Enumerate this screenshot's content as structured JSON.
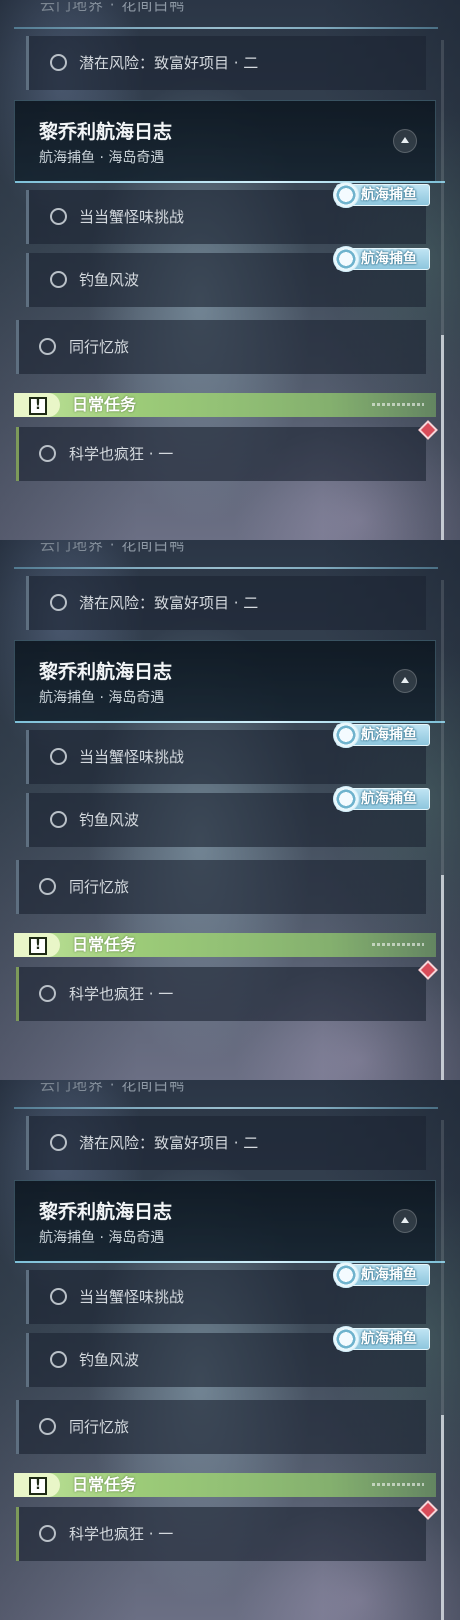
{
  "panels": [
    {
      "cut_text": "云门地界 · 花间白鸭",
      "hidden_item": "潜在风险：致富好项目 · 二",
      "quest_group": {
        "title": "黎乔利航海日志",
        "subtitle": "航海捕鱼 · 海岛奇遇",
        "collapse_icon": "chevron-up-icon"
      },
      "sub_quests": [
        {
          "label": "当当蟹怪味挑战",
          "tag": "航海捕鱼"
        },
        {
          "label": "钓鱼风波",
          "tag": "航海捕鱼"
        }
      ],
      "other_quest": "同行忆旅",
      "daily_section": {
        "title": "日常任务",
        "icon": "exclamation-icon"
      },
      "daily_quests": [
        "科学也疯狂 · 一"
      ]
    },
    {
      "cut_text": "云门地界 · 花间白鸭",
      "hidden_item": "潜在风险：致富好项目 · 二",
      "quest_group": {
        "title": "黎乔利航海日志",
        "subtitle": "航海捕鱼 · 海岛奇遇",
        "collapse_icon": "chevron-up-icon"
      },
      "sub_quests": [
        {
          "label": "当当蟹怪味挑战",
          "tag": "航海捕鱼"
        },
        {
          "label": "钓鱼风波",
          "tag": "航海捕鱼"
        }
      ],
      "other_quest": "同行忆旅",
      "daily_section": {
        "title": "日常任务",
        "icon": "exclamation-icon"
      },
      "daily_quests": [
        "科学也疯狂 · 一"
      ]
    },
    {
      "cut_text": "云门地界 · 花间白鸭",
      "hidden_item": "潜在风险：致富好项目 · 二",
      "quest_group": {
        "title": "黎乔利航海日志",
        "subtitle": "航海捕鱼 · 海岛奇遇",
        "collapse_icon": "chevron-up-icon"
      },
      "sub_quests": [
        {
          "label": "当当蟹怪味挑战",
          "tag": "航海捕鱼"
        },
        {
          "label": "钓鱼风波",
          "tag": "航海捕鱼"
        }
      ],
      "other_quest": "同行忆旅",
      "daily_section": {
        "title": "日常任务",
        "icon": "exclamation-icon"
      },
      "daily_quests": [
        "科学也疯狂 · 一"
      ]
    }
  ],
  "colors": {
    "header_line": "#b6e0f0",
    "daily_green": "#9ccb78",
    "tag_blue": "#8ec6dd",
    "new_marker": "#d94c5a"
  }
}
